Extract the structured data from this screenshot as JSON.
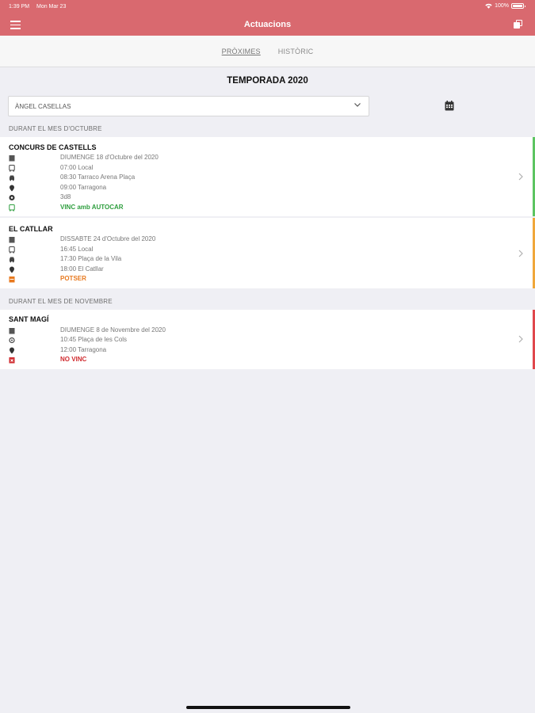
{
  "status_bar": {
    "time": "1:39 PM",
    "date": "Mon Mar 23",
    "battery": "100%"
  },
  "nav": {
    "title": "Actuacions"
  },
  "tabs": [
    {
      "label": "PRÒXIMES",
      "active": true
    },
    {
      "label": "HISTÒRIC",
      "active": false
    }
  ],
  "season": "TEMPORADA 2020",
  "member_select": {
    "value": "ÀNGEL CASELLAS"
  },
  "sections": [
    {
      "label": "DURANT EL MES D'OCTUBRE"
    },
    {
      "label": "DURANT EL MES DE NOVEMBRE"
    }
  ],
  "events": [
    {
      "name": "CONCURS DE CASTELLS",
      "status_color": "#5cc461",
      "rows": [
        {
          "icon": "calendar-icon",
          "text": "DIUMENGE 18 d'Octubre del 2020"
        },
        {
          "icon": "bus-icon",
          "text": "07:00 Local"
        },
        {
          "icon": "car-icon",
          "text": "08:30 Tarraco Arena Plaça"
        },
        {
          "icon": "location-pin-icon",
          "text": "09:00 Tarragona"
        },
        {
          "icon": "castell-icon",
          "text": "3d8"
        },
        {
          "icon": "bus-status-icon",
          "text": "VINC amb AUTOCAR",
          "status": "#2e9e3e"
        }
      ]
    },
    {
      "name": "EL CATLLAR",
      "status_color": "#f0a73a",
      "rows": [
        {
          "icon": "calendar-icon",
          "text": "DISSABTE 24 d'Octubre del 2020"
        },
        {
          "icon": "bus-icon",
          "text": "16:45 Local"
        },
        {
          "icon": "car-icon",
          "text": "17:30 Plaça de la Vila"
        },
        {
          "icon": "location-pin-icon",
          "text": "18:00 El Catllar"
        },
        {
          "icon": "maybe-icon",
          "text": "POTSER",
          "status": "#e8791e"
        }
      ]
    },
    {
      "name": "SANT MAGÍ",
      "status_color": "#e0474c",
      "rows": [
        {
          "icon": "calendar-icon",
          "text": "DIUMENGE 8 de Novembre del 2020"
        },
        {
          "icon": "meeting-point-icon",
          "text": "10:45 Plaça de les Cols"
        },
        {
          "icon": "location-pin-icon",
          "text": "12:00 Tarragona"
        },
        {
          "icon": "cancel-icon",
          "text": "NO VINC",
          "status": "#d02c30"
        }
      ]
    }
  ]
}
